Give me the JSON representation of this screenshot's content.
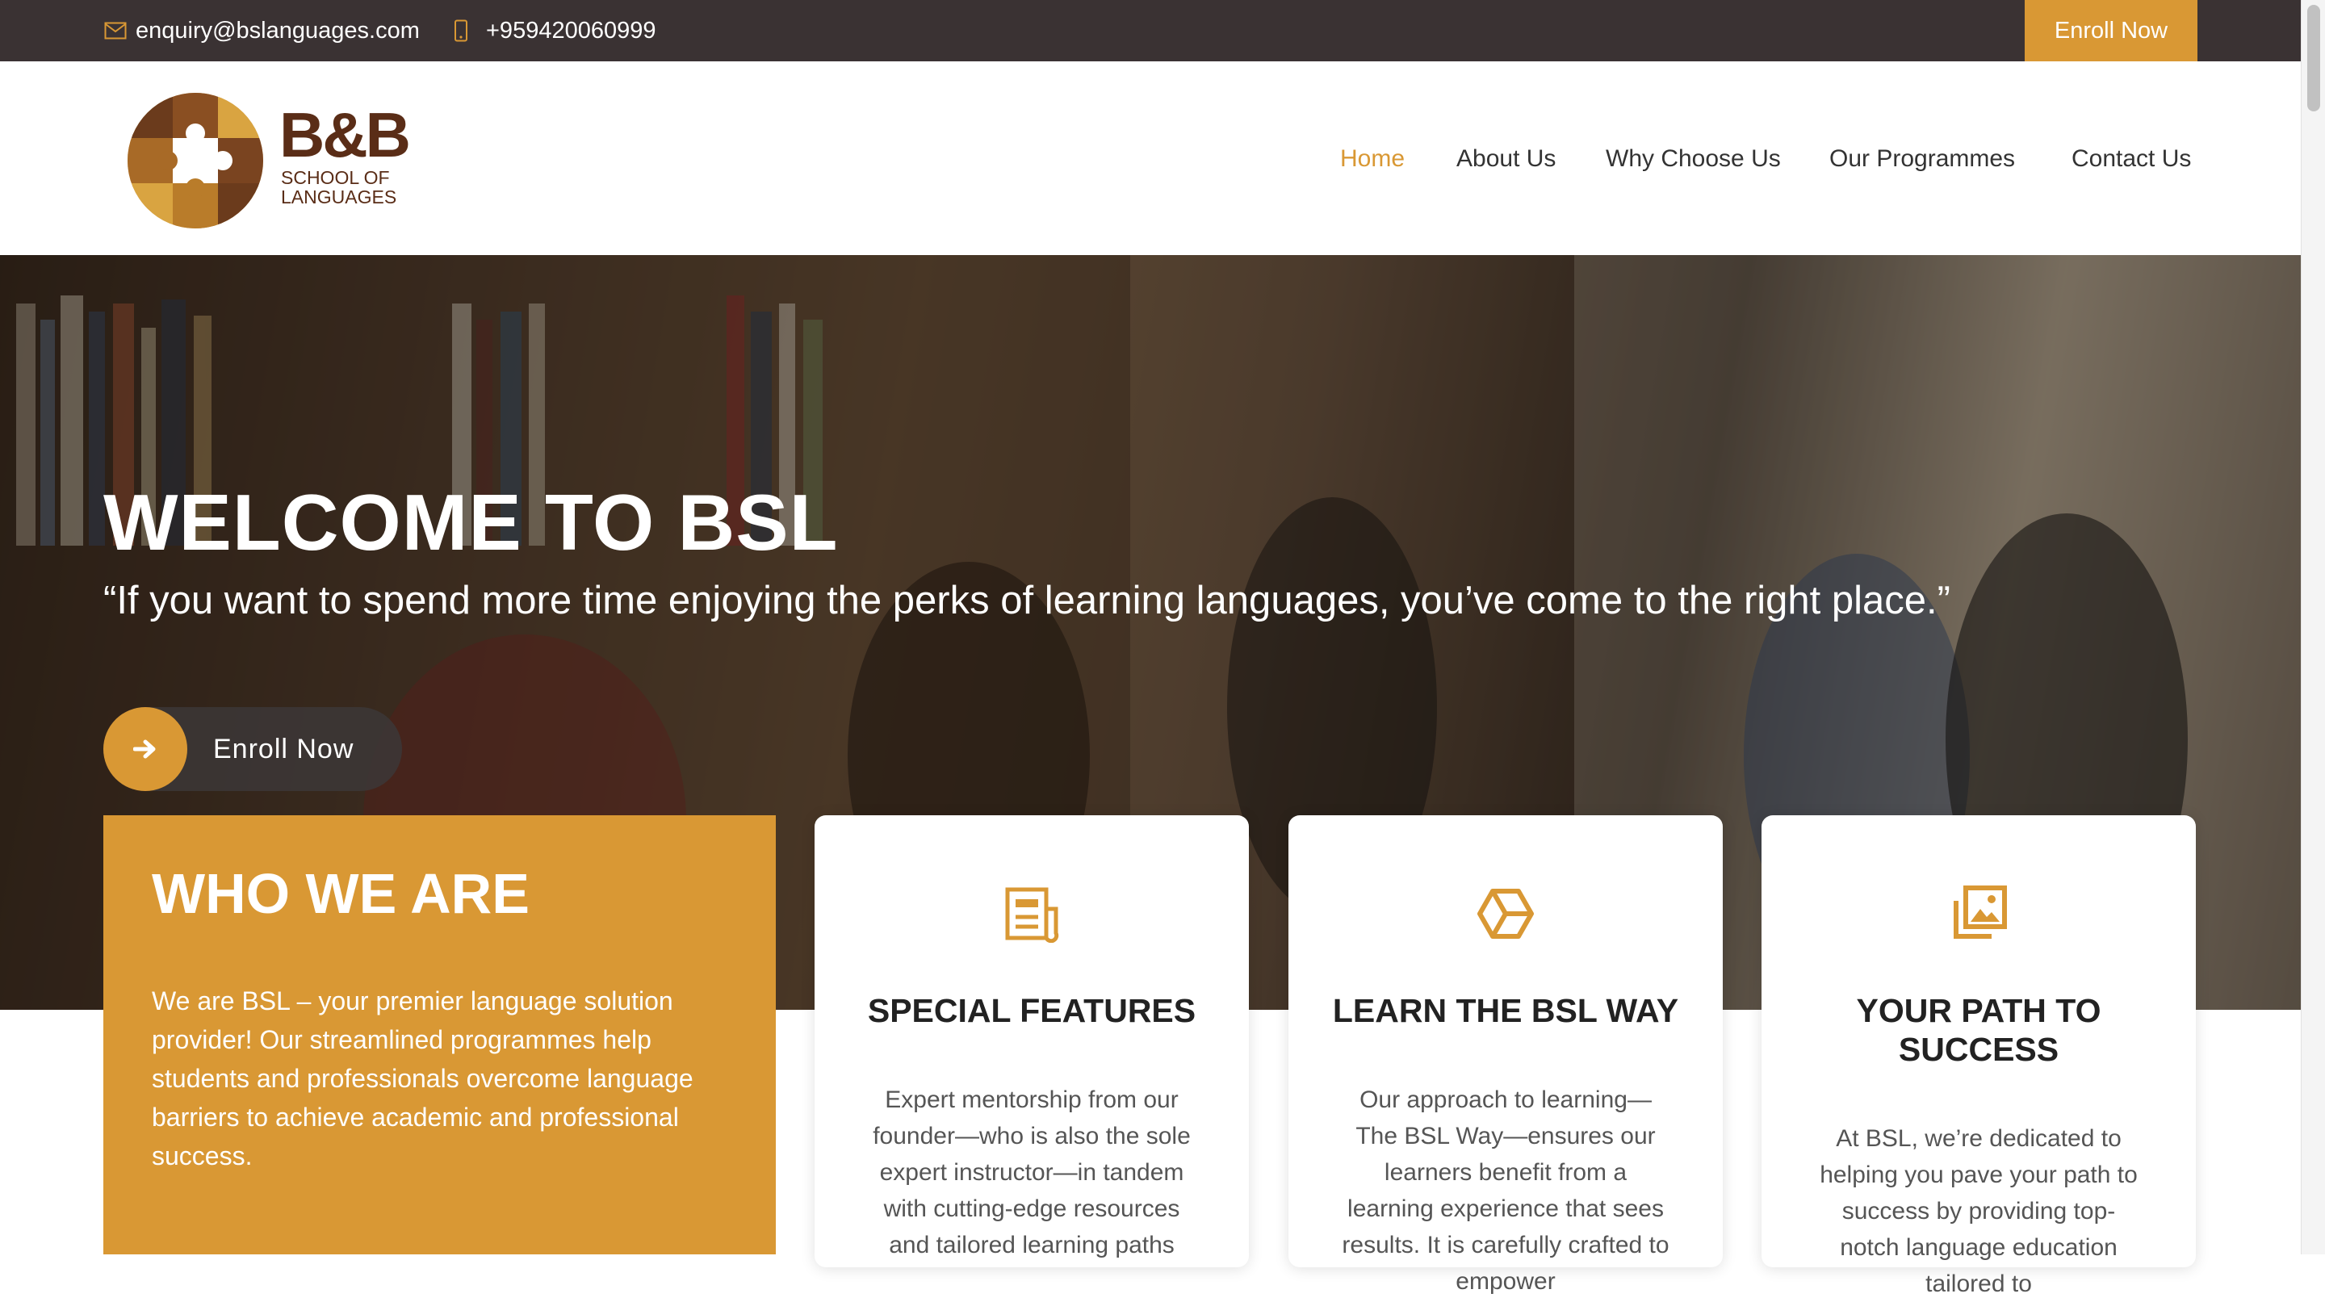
{
  "topbar": {
    "email": "enquiry@bslanguages.com",
    "phone": "+959420060999",
    "enroll_label": "Enroll Now"
  },
  "brand": {
    "name": "B&B",
    "sub_line1": "SCHOOL OF",
    "sub_line2": "LANGUAGES"
  },
  "nav": {
    "items": [
      {
        "label": "Home",
        "active": true
      },
      {
        "label": "About Us"
      },
      {
        "label": "Why Choose Us"
      },
      {
        "label": "Our Programmes"
      },
      {
        "label": "Contact Us"
      }
    ]
  },
  "hero": {
    "title": "WELCOME TO BSL",
    "quote": "“If you want to spend more time enjoying the perks of learning languages, you’ve come to the right place.”",
    "button_label": "Enroll Now"
  },
  "who": {
    "title": "WHO WE ARE",
    "text": "We are BSL – your premier language solution provider! Our streamlined programmes help students and professionals overcome language barriers to achieve academic and professional success."
  },
  "cards": [
    {
      "icon": "document-icon",
      "title": "SPECIAL FEATURES",
      "text": "Expert mentorship from our founder—who is also the sole expert instructor—in tandem with cutting-edge resources and tailored learning paths"
    },
    {
      "icon": "hexagon-icon",
      "title": "LEARN THE BSL WAY",
      "text": "Our approach to learning—The BSL Way—ensures our learners benefit from a learning experience that sees results. It is carefully crafted to empower"
    },
    {
      "icon": "gallery-icon",
      "title": "YOUR PATH TO SUCCESS",
      "text": "At BSL, we’re dedicated to helping you pave your path to success by providing top-notch language education tailored to"
    }
  ],
  "colors": {
    "accent": "#d99834",
    "topbar_bg": "#3a3233",
    "brand_brown": "#5a2d17"
  }
}
